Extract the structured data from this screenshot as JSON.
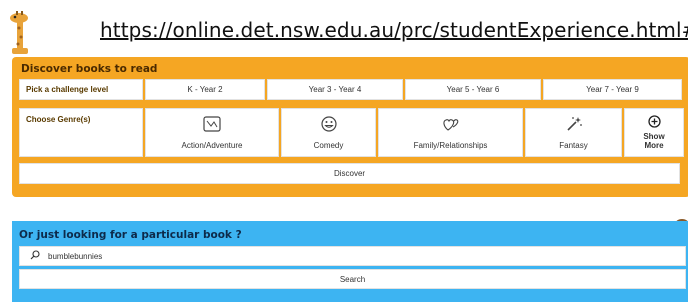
{
  "url": "https://online.det.nsw.edu.au/prc/studentExperience.html#/",
  "discover": {
    "heading": "Discover books to read",
    "challenge_label": "Pick a challenge level",
    "levels": [
      "K - Year 2",
      "Year 3 - Year 4",
      "Year 5 - Year 6",
      "Year 7 - Year 9"
    ],
    "genre_label": "Choose Genre(s)",
    "genres": [
      {
        "label": "Action/Adventure",
        "icon": "map-icon"
      },
      {
        "label": "Comedy",
        "icon": "smiley-icon"
      },
      {
        "label": "Family/Relationships",
        "icon": "hearts-icon"
      },
      {
        "label": "Fantasy",
        "icon": "magic-wand-icon"
      }
    ],
    "show_more": {
      "line1": "Show",
      "line2": "More",
      "icon": "plus-circle-icon"
    },
    "discover_button": "Discover"
  },
  "search": {
    "heading": "Or just looking for a particular book ?",
    "value": "bumblebunnies",
    "button": "Search"
  }
}
